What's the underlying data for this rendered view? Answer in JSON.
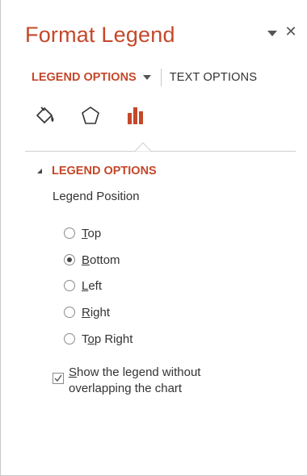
{
  "pane": {
    "title": "Format Legend",
    "menu_icon": "dropdown-caret-icon",
    "close_icon": "close-icon",
    "close_glyph": "✕"
  },
  "tabs": {
    "legend_options": "LEGEND OPTIONS",
    "text_options": "TEXT OPTIONS"
  },
  "icons": [
    "fill-line-icon",
    "effects-pentagon-icon",
    "legend-options-bars-icon"
  ],
  "section": {
    "label": "LEGEND OPTIONS",
    "expanded": true
  },
  "legend_position": {
    "label": "Legend Position",
    "options": [
      {
        "accel": "T",
        "rest": "op",
        "checked": false
      },
      {
        "accel": "B",
        "rest": "ottom",
        "checked": true
      },
      {
        "accel": "L",
        "rest": "eft",
        "checked": false
      },
      {
        "accel": "R",
        "rest": "ight",
        "checked": false
      },
      {
        "pre": "T",
        "accel": "o",
        "rest": "p Right",
        "checked": false
      }
    ],
    "selected": "Bottom"
  },
  "overlap_checkbox": {
    "accel": "S",
    "line1_rest": "how the legend without",
    "line2": "overlapping the chart",
    "checked": true
  },
  "colors": {
    "accent": "#c4482a",
    "text": "#333333",
    "divider": "#d0d0d0"
  }
}
